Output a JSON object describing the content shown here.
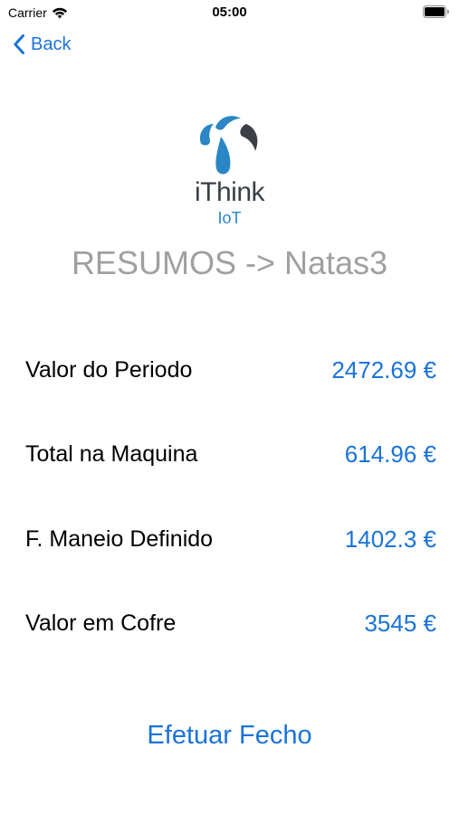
{
  "status_bar": {
    "carrier": "Carrier",
    "time": "05:00",
    "wifi_icon": "wifi-icon",
    "battery_icon": "battery-icon"
  },
  "nav": {
    "back_label": "Back",
    "back_icon": "chevron-left-icon"
  },
  "logo": {
    "name": "iThink",
    "sub": "IoT",
    "colors": {
      "mark_blue": "#2a86c4",
      "mark_dark": "#3a4046"
    }
  },
  "screen_title": "RESUMOS -> Natas3",
  "rows": [
    {
      "label": "Valor do Periodo",
      "value": "2472.69 €"
    },
    {
      "label": "Total na Maquina",
      "value": "614.96 €"
    },
    {
      "label": "F. Maneio Definido",
      "value": "1402.3 €"
    },
    {
      "label": "Valor em Cofre",
      "value": "3545 €"
    }
  ],
  "action": {
    "label": "Efetuar Fecho"
  },
  "colors": {
    "accent": "#1a73d9",
    "title_gray": "#a0a0a0",
    "background": "#ffffff"
  }
}
